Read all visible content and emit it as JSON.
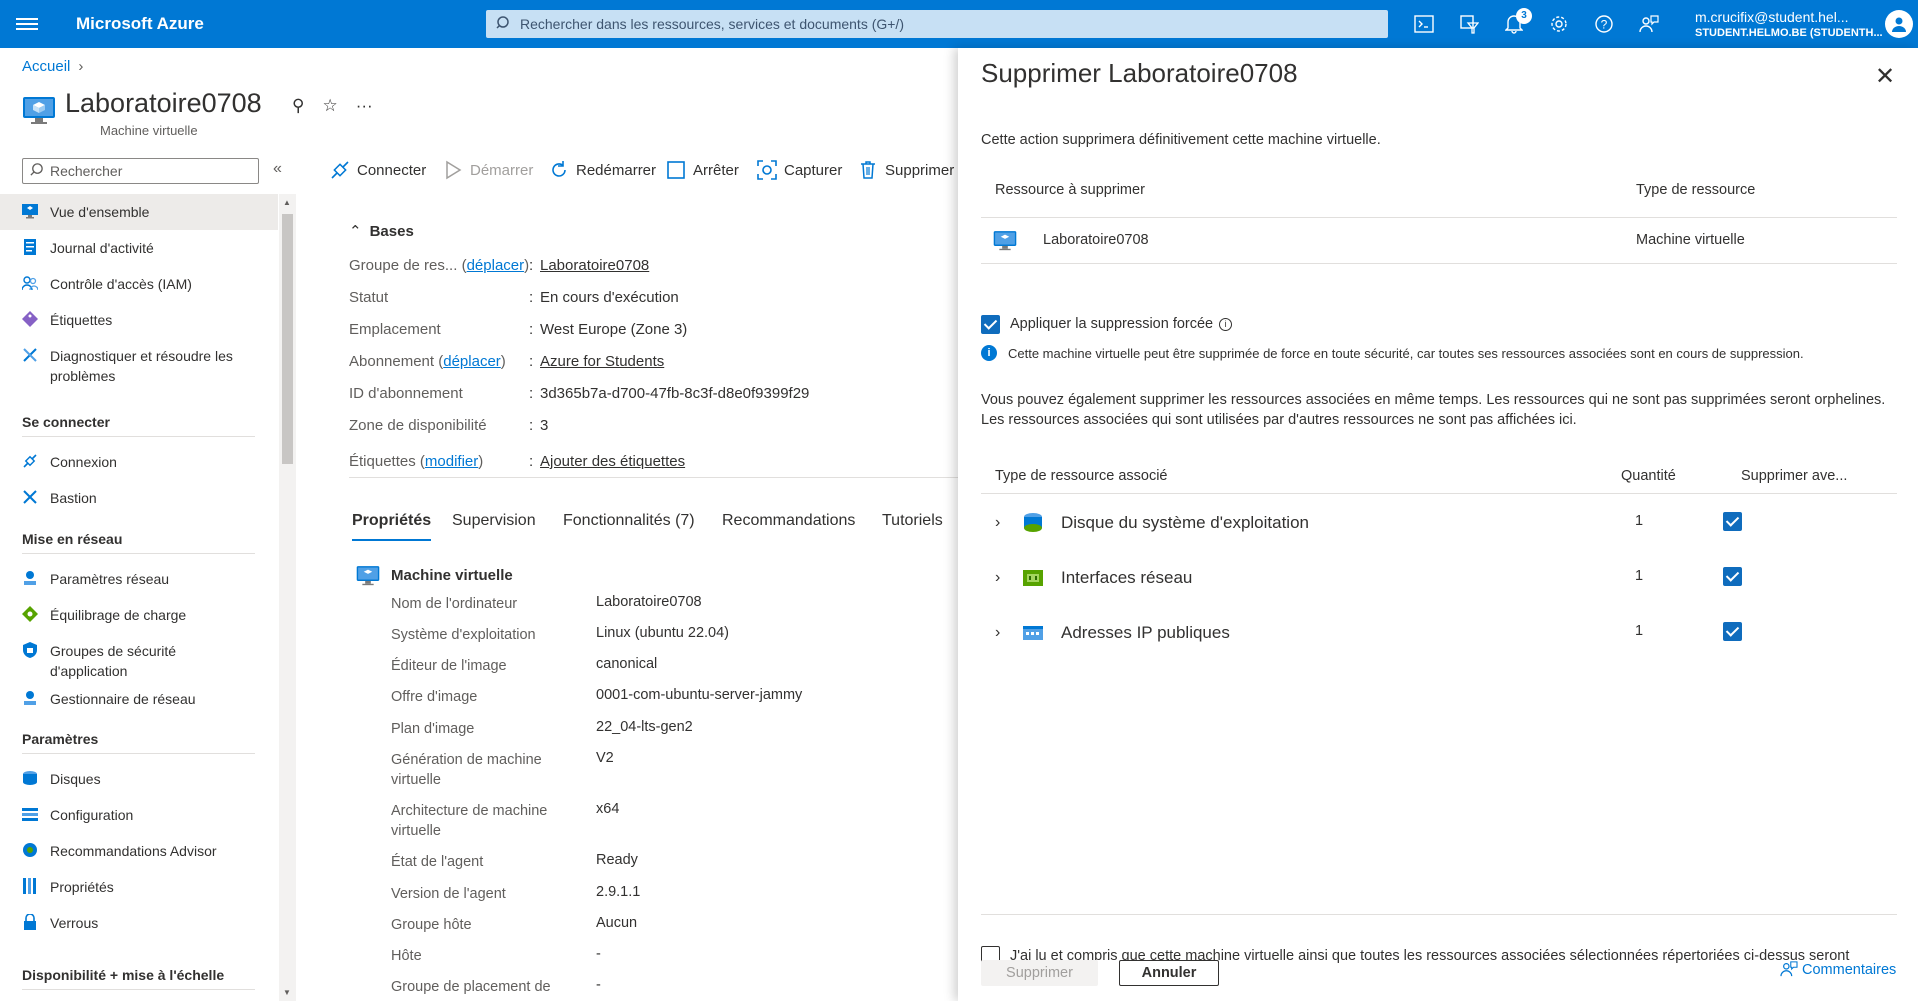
{
  "topbar": {
    "brand": "Microsoft Azure",
    "search_placeholder": "Rechercher dans les ressources, services et documents (G+/)",
    "notifications_count": "3",
    "user_email": "m.crucifix@student.hel...",
    "user_org": "STUDENT.HELMO.BE (STUDENTH..."
  },
  "breadcrumb": {
    "home": "Accueil"
  },
  "resource": {
    "name": "Laboratoire0708",
    "type": "Machine virtuelle"
  },
  "sidebar": {
    "search_placeholder": "Rechercher",
    "items": [
      {
        "label": "Vue d'ensemble",
        "icon": "monitor-icon"
      },
      {
        "label": "Journal d'activité",
        "icon": "log-icon"
      },
      {
        "label": "Contrôle d'accès (IAM)",
        "icon": "people-icon"
      },
      {
        "label": "Étiquettes",
        "icon": "tag-icon"
      },
      {
        "label": "Diagnostiquer et résoudre les problèmes",
        "icon": "wrench-icon"
      }
    ],
    "sections": [
      {
        "title": "Se connecter",
        "items": [
          {
            "label": "Connexion",
            "icon": "plug-icon"
          },
          {
            "label": "Bastion",
            "icon": "bastion-icon"
          }
        ]
      },
      {
        "title": "Mise en réseau",
        "items": [
          {
            "label": "Paramètres réseau",
            "icon": "network-icon"
          },
          {
            "label": "Équilibrage de charge",
            "icon": "loadbalancer-icon"
          },
          {
            "label": "Groupes de sécurité d'application",
            "icon": "shield-icon"
          },
          {
            "label": "Gestionnaire de réseau",
            "icon": "network-manager-icon"
          }
        ]
      },
      {
        "title": "Paramètres",
        "items": [
          {
            "label": "Disques",
            "icon": "disk-icon"
          },
          {
            "label": "Configuration",
            "icon": "config-icon"
          },
          {
            "label": "Recommandations Advisor",
            "icon": "advisor-icon"
          },
          {
            "label": "Propriétés",
            "icon": "properties-icon"
          },
          {
            "label": "Verrous",
            "icon": "lock-icon"
          }
        ]
      },
      {
        "title": "Disponibilité + mise à l'échelle",
        "items": []
      }
    ]
  },
  "commands": {
    "connect": "Connecter",
    "start": "Démarrer",
    "restart": "Redémarrer",
    "stop": "Arrêter",
    "capture": "Capturer",
    "delete": "Supprimer"
  },
  "essentials": {
    "title": "Bases",
    "rows": [
      {
        "key": "Groupe de res...",
        "key_link": "déplacer",
        "value": "Laboratoire0708",
        "value_link": true
      },
      {
        "key": "Statut",
        "value": "En cours d'exécution"
      },
      {
        "key": "Emplacement",
        "value": "West Europe (Zone 3)"
      },
      {
        "key": "Abonnement",
        "key_link": "déplacer",
        "value": "Azure for Students",
        "value_link": true
      },
      {
        "key": "ID d'abonnement",
        "value": "3d365b7a-d700-47fb-8c3f-d8e0f9399f29"
      },
      {
        "key": "Zone de disponibilité",
        "value": "3"
      },
      {
        "key": "Étiquettes",
        "key_link": "modifier",
        "value": "Ajouter des étiquettes",
        "value_link": true
      }
    ]
  },
  "tabs": [
    "Propriétés",
    "Supervision",
    "Fonctionnalités (7)",
    "Recommandations",
    "Tutoriels"
  ],
  "properties": {
    "title": "Machine virtuelle",
    "rows": [
      {
        "key": "Nom de l'ordinateur",
        "value": "Laboratoire0708"
      },
      {
        "key": "Système d'exploitation",
        "value": "Linux (ubuntu 22.04)"
      },
      {
        "key": "Éditeur de l'image",
        "value": "canonical"
      },
      {
        "key": "Offre d'image",
        "value": "0001-com-ubuntu-server-jammy"
      },
      {
        "key": "Plan d'image",
        "value": "22_04-lts-gen2"
      },
      {
        "key": "Génération de machine virtuelle",
        "value": "V2"
      },
      {
        "key": "Architecture de machine virtuelle",
        "value": "x64"
      },
      {
        "key": "État de l'agent",
        "value": "Ready"
      },
      {
        "key": "Version de l'agent",
        "value": "2.9.1.1"
      },
      {
        "key": "Groupe hôte",
        "value": "Aucun"
      },
      {
        "key": "Hôte",
        "value": "-"
      },
      {
        "key": "Groupe de placement de",
        "value": "-"
      }
    ]
  },
  "panel": {
    "title": "Supprimer Laboratoire0708",
    "description": "Cette action supprimera définitivement cette machine virtuelle.",
    "col_resource": "Ressource à supprimer",
    "col_type": "Type de ressource",
    "resource_name": "Laboratoire0708",
    "resource_type": "Machine virtuelle",
    "force_delete_label": "Appliquer la suppression forcée",
    "force_delete_checked": true,
    "info_text": "Cette machine virtuelle peut être supprimée de force en toute sécurité, car toutes ses ressources associées sont en cours de suppression.",
    "paragraph": "Vous pouvez également supprimer les ressources associées en même temps. Les ressources qui ne sont pas supprimées seront orphelines. Les ressources associées qui sont utilisées par d'autres ressources ne sont pas affichées ici.",
    "assoc_col_type": "Type de ressource associé",
    "assoc_col_qty": "Quantité",
    "assoc_col_delete": "Supprimer ave...",
    "associated": [
      {
        "name": "Disque du système d'exploitation",
        "qty": "1",
        "checked": true,
        "icon": "disk-icon"
      },
      {
        "name": "Interfaces réseau",
        "qty": "1",
        "checked": true,
        "icon": "nic-icon"
      },
      {
        "name": "Adresses IP publiques",
        "qty": "1",
        "checked": true,
        "icon": "public-ip-icon"
      }
    ],
    "ack_text": "J'ai lu et compris que cette machine virtuelle ainsi que toutes les ressources associées sélectionnées répertoriées ci-dessus seront supprimées.",
    "delete_button": "Supprimer",
    "cancel_button": "Annuler",
    "feedback": "Commentaires"
  },
  "colors": {
    "accent": "#0078d4",
    "topbar": "#0078d4"
  }
}
